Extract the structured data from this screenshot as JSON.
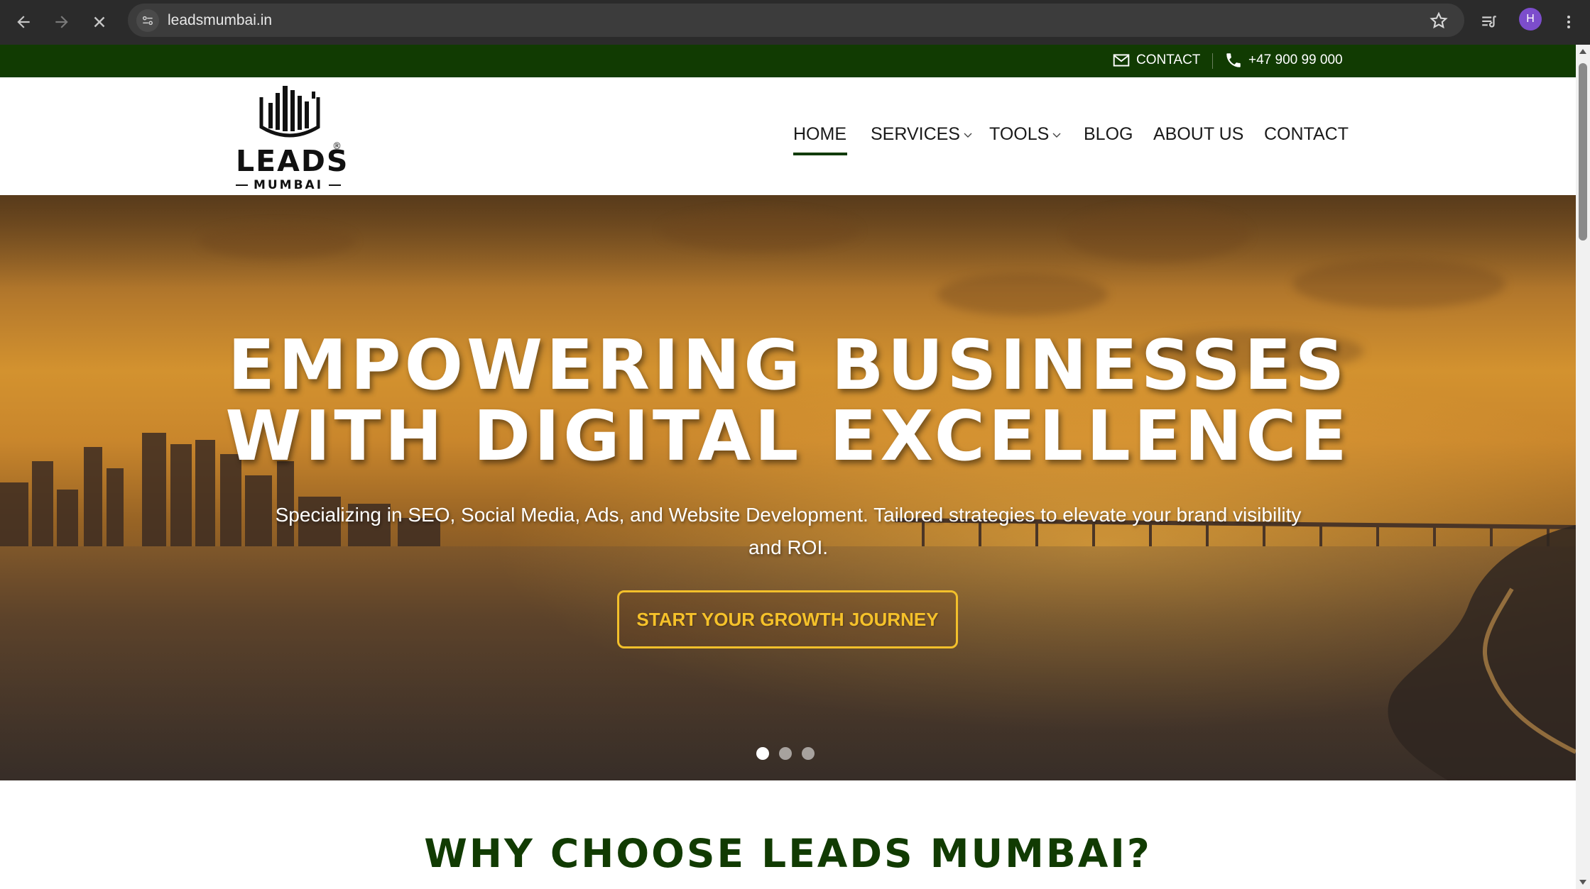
{
  "browser": {
    "url": "leadsmumbai.in",
    "avatar_letter": "H",
    "icons": [
      "back-icon",
      "forward-icon",
      "stop-loading-icon",
      "site-info-icon",
      "bookmark-star-icon",
      "reading-list-icon",
      "menu-dots-icon"
    ]
  },
  "topbar": {
    "contact_label": "CONTACT",
    "phone": "+47 900 99 000",
    "background": "#113b02"
  },
  "logo": {
    "brand": "LEADS",
    "sub": "MUMBAI",
    "registered": "®"
  },
  "nav": {
    "items": [
      {
        "label": "HOME",
        "active": true
      },
      {
        "label": "SERVICES",
        "dropdown": true
      },
      {
        "label": "TOOLS",
        "dropdown": true
      },
      {
        "label": "BLOG"
      },
      {
        "label": "ABOUT US"
      },
      {
        "label": "CONTACT"
      }
    ]
  },
  "hero": {
    "title_line1": "EMPOWERING BUSINESSES",
    "title_line2": "WITH DIGITAL EXCELLENCE",
    "subtitle": "Specializing in SEO, Social Media, Ads, and Website Development. Tailored strategies to elevate your brand visibility and ROI.",
    "cta": "START YOUR GROWTH JOURNEY",
    "cta_color": "#f3c02b",
    "slides": 3,
    "active_slide": 1
  },
  "section": {
    "title": "WHY CHOOSE LEADS MUMBAI?",
    "color": "#113b02"
  }
}
